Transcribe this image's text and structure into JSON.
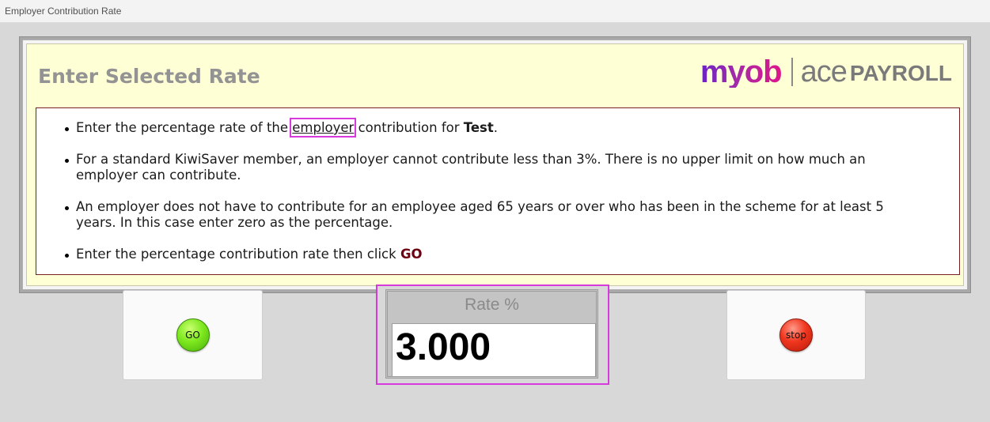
{
  "window": {
    "title": "Employer Contribution Rate"
  },
  "panel": {
    "heading": "Enter Selected Rate",
    "logo": {
      "myob": "myob",
      "ace": "ace",
      "payroll": "PAYROLL"
    }
  },
  "info": {
    "line1": {
      "pre": "Enter the percentage rate of the ",
      "link": "employer",
      "mid": " contribution for ",
      "name": "Test",
      "post": "."
    },
    "line2": "For a standard KiwiSaver member, an employer cannot contribute less than 3%. There is no upper limit on how much an employer can contribute.",
    "line3": "An employer does not have to contribute for an employee aged 65 years or over who has been in the scheme for at least 5 years. In this case enter zero as the percentage.",
    "line4": {
      "pre": "Enter the percentage contribution rate then click ",
      "go": "GO"
    }
  },
  "buttons": {
    "go": "GO",
    "stop": "stop"
  },
  "rate": {
    "label": "Rate %",
    "value": "3.000"
  },
  "colors": {
    "highlight": "#d63adc",
    "panel_bg": "#ffffd6",
    "go": "#7ee81f",
    "stop": "#f0361e"
  }
}
